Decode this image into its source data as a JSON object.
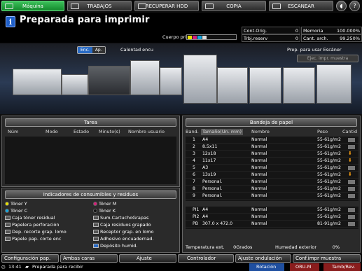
{
  "tabs": [
    {
      "label": "Máquina",
      "icon": "machine-icon",
      "active": true
    },
    {
      "label": "TRABAJOS",
      "icon": "jobs-icon"
    },
    {
      "label": "RECUPERAR HDD",
      "icon": "hdd-icon"
    },
    {
      "label": "COPIA",
      "icon": "copy-icon"
    },
    {
      "label": "ESCANEAR",
      "icon": "scan-icon"
    }
  ],
  "status": {
    "message": "Preparada para imprimir",
    "cuerpo_label": "Cuerpo prin."
  },
  "counters": {
    "cont_orig_label": "Cont.Orig.",
    "cont_orig_value": "0",
    "memoria_label": "Memoria",
    "memoria_value": "100.000%",
    "trbj_reserv_label": "Trbj.reserv",
    "trbj_reserv_value": "0",
    "cant_arch_label": "Cant. arch.",
    "cant_arch_value": "99.250%"
  },
  "banner": {
    "enc": "Enc.",
    "ap": "Ap.",
    "calentad": "Calentad encu",
    "prep": "Prep. para usar Escáner",
    "ejec": "Ejec. impr. muestra"
  },
  "tarea": {
    "title": "Tarea",
    "columns": [
      "Núm",
      "Modo",
      "Estado",
      "Minuto(s)",
      "Nombre usuario"
    ]
  },
  "bandeja": {
    "title": "Bandeja de papel",
    "columns": [
      "Band.",
      "Tamaño(Un. mm)",
      "Nombre",
      "Peso",
      "Cantid"
    ],
    "rows": [
      {
        "tray": "1",
        "size": "A4",
        "name": "Normal",
        "weight": "55-61g/m2",
        "level": "full"
      },
      {
        "tray": "2",
        "size": "8.5x11",
        "name": "Normal",
        "weight": "55-61g/m2",
        "level": "full"
      },
      {
        "tray": "3",
        "size": "12x18",
        "name": "Normal",
        "weight": "55-61g/m2",
        "level": "low"
      },
      {
        "tray": "4",
        "size": "11x17",
        "name": "Normal",
        "weight": "55-61g/m2",
        "level": "low"
      },
      {
        "tray": "5",
        "size": "A3",
        "name": "Normal",
        "weight": "55-61g/m2",
        "level": "full"
      },
      {
        "tray": "6",
        "size": "13x19",
        "name": "Normal",
        "weight": "55-61g/m2",
        "level": "low"
      },
      {
        "tray": "7",
        "size": "Personal.",
        "name": "Normal",
        "weight": "55-61g/m2",
        "level": "full"
      },
      {
        "tray": "8",
        "size": "Personal.",
        "name": "Normal",
        "weight": "55-61g/m2",
        "level": "full"
      },
      {
        "tray": "9",
        "size": "Personal.",
        "name": "Normal",
        "weight": "55-61g/m2",
        "level": "full"
      }
    ],
    "rows2": [
      {
        "tray": "PI1",
        "size": "A4",
        "name": "Normal",
        "weight": "55-61g/m2",
        "level": "full"
      },
      {
        "tray": "PI2",
        "size": "A4",
        "name": "Normal",
        "weight": "55-61g/m2",
        "level": "full"
      },
      {
        "tray": "PB",
        "size": "307.0 x 472.0",
        "name": "Normal",
        "weight": "81-91g/m2",
        "level": "full"
      }
    ],
    "temp_label": "Temperatura ext.",
    "temp_value": "0Grados",
    "hum_label": "Humedad exterior",
    "hum_value": "0%"
  },
  "consumibles": {
    "title": "Indicadores de consumibles y residuos",
    "left": [
      "Tóner Y",
      "Tóner C",
      "Caja tóner residual",
      "Papelera perforación",
      "Dep. recorte grap. lomo",
      "Papele pap. corte enc"
    ],
    "right": [
      "Tóner M",
      "Tóner K",
      "Sum.CartuchoGrapas",
      "Caja residuos grapado",
      "Receptor grap. en lomo",
      "Adhesivo encuadernad.",
      "Depósito humid."
    ]
  },
  "buttons": [
    "Configuración pap.",
    "Ambas caras",
    "Ajuste",
    "Controlador",
    "Ajuste ondulación",
    "Conf.impr muestra"
  ],
  "footer": {
    "time": "13:41",
    "msg": "Preparada para recibir",
    "rotacion": "Rotación",
    "oru": "ORU-M",
    "tamb": "Tamb/Rev."
  },
  "colors": {
    "active_tab": "#28a745",
    "info": "#1f5fc8",
    "arrow_warn": "#f39c12"
  }
}
